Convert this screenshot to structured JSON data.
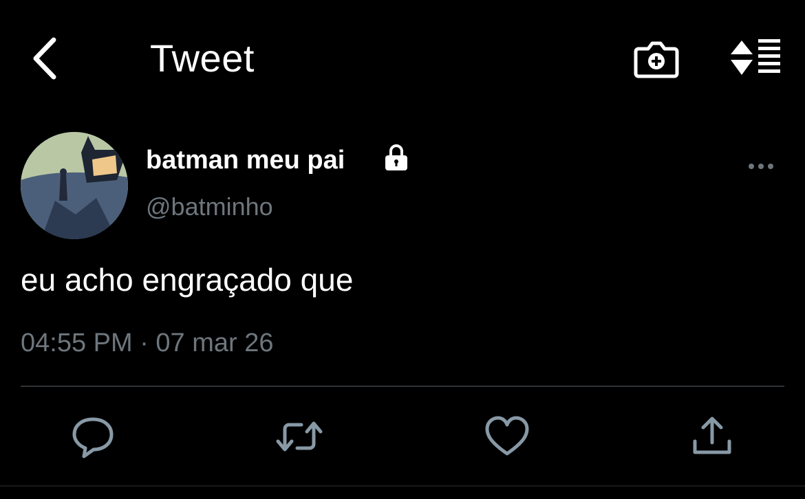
{
  "header": {
    "title": "Tweet"
  },
  "tweet": {
    "display_name": "batman meu pai",
    "handle": "@batminho",
    "text": "eu acho engraçado que",
    "timestamp": "04:55 PM · 07 mar 26"
  },
  "icons": {
    "back": "chevron-left-icon",
    "camera": "camera-add-icon",
    "sort": "sort-icon",
    "lock": "lock-icon",
    "more": "more-icon",
    "reply": "reply-icon",
    "retweet": "retweet-icon",
    "like": "heart-icon",
    "share": "share-icon"
  },
  "colors": {
    "background": "#000000",
    "secondary_text": "#6e767d",
    "icon": "#8899a6"
  }
}
